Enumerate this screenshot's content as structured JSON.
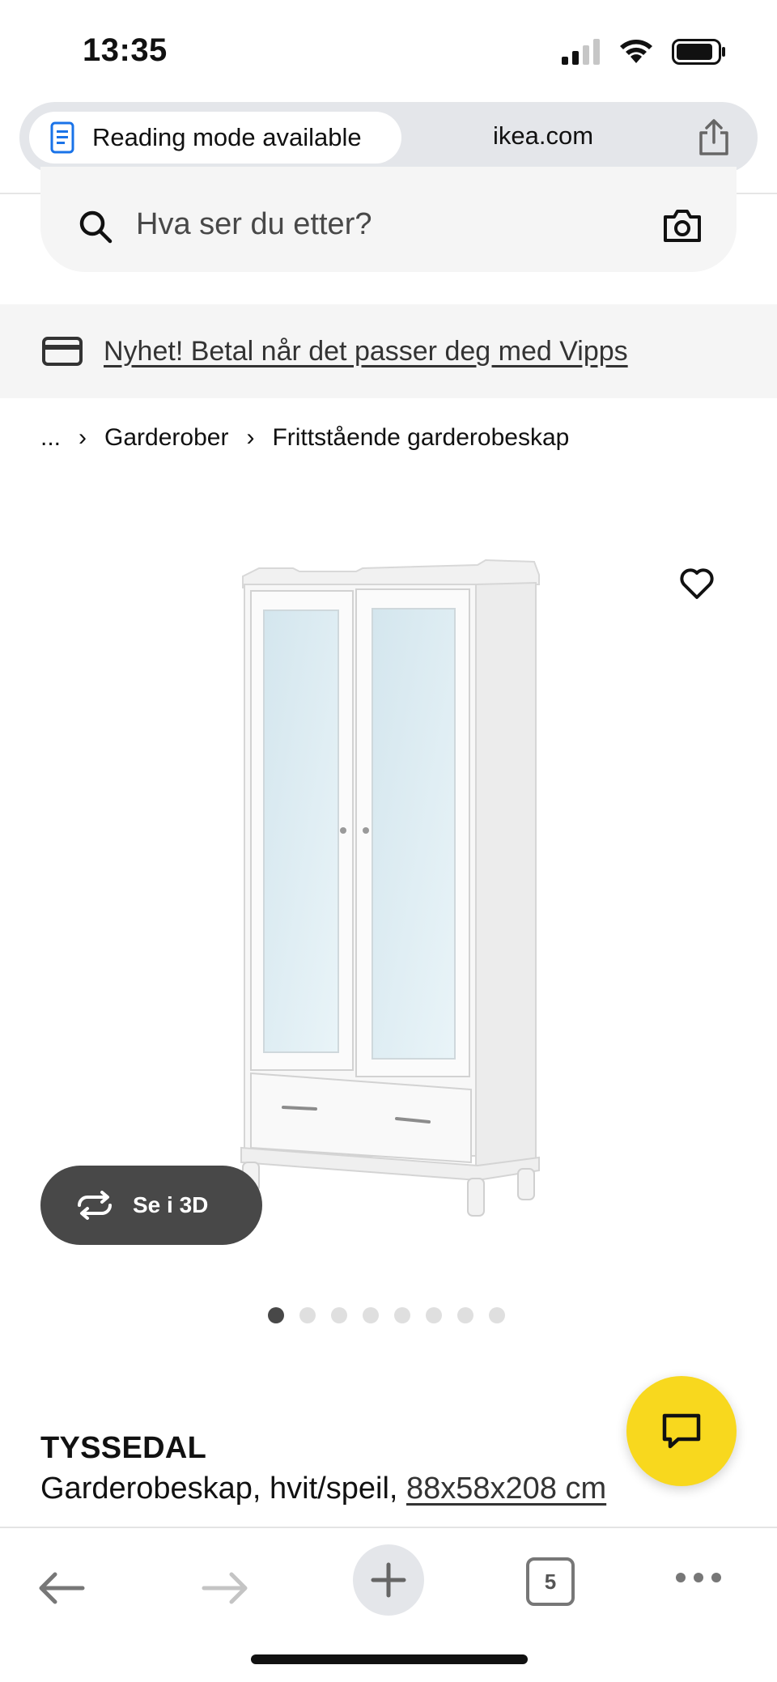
{
  "status_bar": {
    "time": "13:35"
  },
  "address_bar": {
    "reading_mode_label": "Reading mode available",
    "domain": "ikea.com"
  },
  "search": {
    "placeholder": "Hva ser du etter?"
  },
  "promo_banner": {
    "text": "Nyhet! Betal når det passer deg med Vipps"
  },
  "breadcrumb": {
    "ellipsis": "...",
    "items": [
      "Garderober",
      "Frittstående garderobeskap"
    ]
  },
  "product": {
    "view_3d_label": "Se i 3D",
    "carousel": {
      "total": 8,
      "active": 1
    },
    "name": "TYSSEDAL",
    "description": "Garderobeskap, hvit/speil,",
    "size": "88x58x208 cm"
  },
  "toolbar": {
    "tab_count": "5"
  },
  "colors": {
    "accent_yellow": "#f8d81e",
    "dark_grey": "#484848",
    "light_grey": "#f5f5f5"
  },
  "icons": [
    "signal-icon",
    "wifi-icon",
    "battery-icon",
    "reading-mode-icon",
    "share-icon",
    "search-icon",
    "camera-icon",
    "card-icon",
    "heart-icon",
    "rotate-3d-icon",
    "chat-icon",
    "back-arrow-icon",
    "forward-arrow-icon",
    "plus-icon",
    "tabs-icon",
    "more-icon"
  ]
}
